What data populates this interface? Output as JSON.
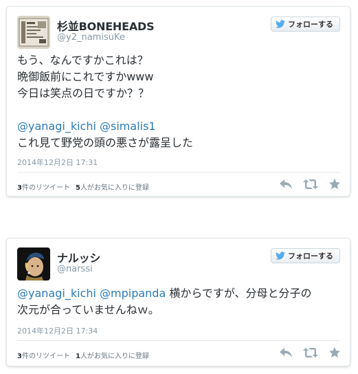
{
  "tweets": [
    {
      "name": "杉並BONEHEADS",
      "handle": "@y2_namisuKe",
      "follow_label": "フォローする",
      "lines": [
        "もう、なんですかこれは？",
        "晩御飯前にこれですかwww",
        "今日は笑点の日ですか？？"
      ],
      "mentions": [
        "@yanagi_kichi",
        "@simalis1"
      ],
      "line_after_mentions": "これ見て野党の頭の悪さが露呈した",
      "timestamp": "2014年12月2日 17:31",
      "retweet_count": "3",
      "retweet_label": "件のリツイート",
      "favorite_count": "5",
      "favorite_label": "人がお気に入りに登録"
    },
    {
      "name": "ナルッシ",
      "handle": "@narssi",
      "follow_label": "フォローする",
      "mentions": [
        "@yanagi_kichi",
        "@mpipanda"
      ],
      "text_after_mentions": "横からですが、分母と分子の",
      "line_2": "次元が合っていませんねｗ。",
      "timestamp": "2014年12月2日 17:34",
      "retweet_count": "3",
      "retweet_label": "件のリツイート",
      "favorite_count": "1",
      "favorite_label": "人がお気に入りに登録"
    }
  ],
  "colors": {
    "link": "#2b7bb9",
    "meta": "#8899a6",
    "action_icon": "#99aab5",
    "twitter_bird": "#55acee"
  },
  "icons": [
    "twitter-bird-icon",
    "reply-icon",
    "retweet-icon",
    "favorite-star-icon"
  ]
}
